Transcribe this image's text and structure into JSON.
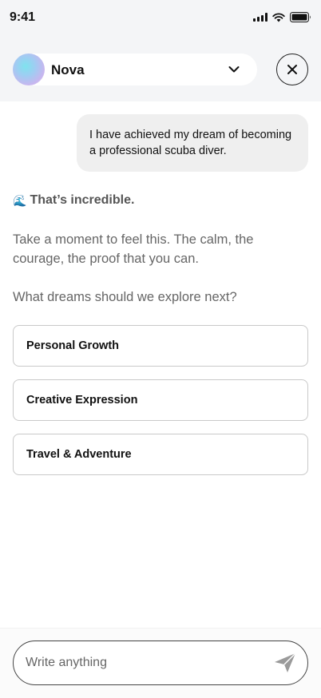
{
  "status_bar": {
    "time": "9:41"
  },
  "header": {
    "name": "Nova",
    "avatar_icon": "gradient-orb",
    "dropdown_icon": "chevron-down-icon",
    "close_icon": "close-icon"
  },
  "conversation": {
    "user_message": "I have achieved my dream of becoming a professional scuba diver.",
    "reply": {
      "emoji": "🌊",
      "title": "That’s incredible.",
      "body": "Take a moment to feel this. The calm, the courage, the proof that you can.",
      "question": "What dreams should we explore next?"
    },
    "options": [
      {
        "label": "Personal Growth"
      },
      {
        "label": "Creative Expression"
      },
      {
        "label": "Travel & Adventure"
      }
    ]
  },
  "composer": {
    "placeholder": "Write anything",
    "send_icon": "send-icon"
  },
  "colors": {
    "header_bg": "#f4f5f7",
    "bubble_bg": "#efefef",
    "reply_text": "#666666"
  }
}
